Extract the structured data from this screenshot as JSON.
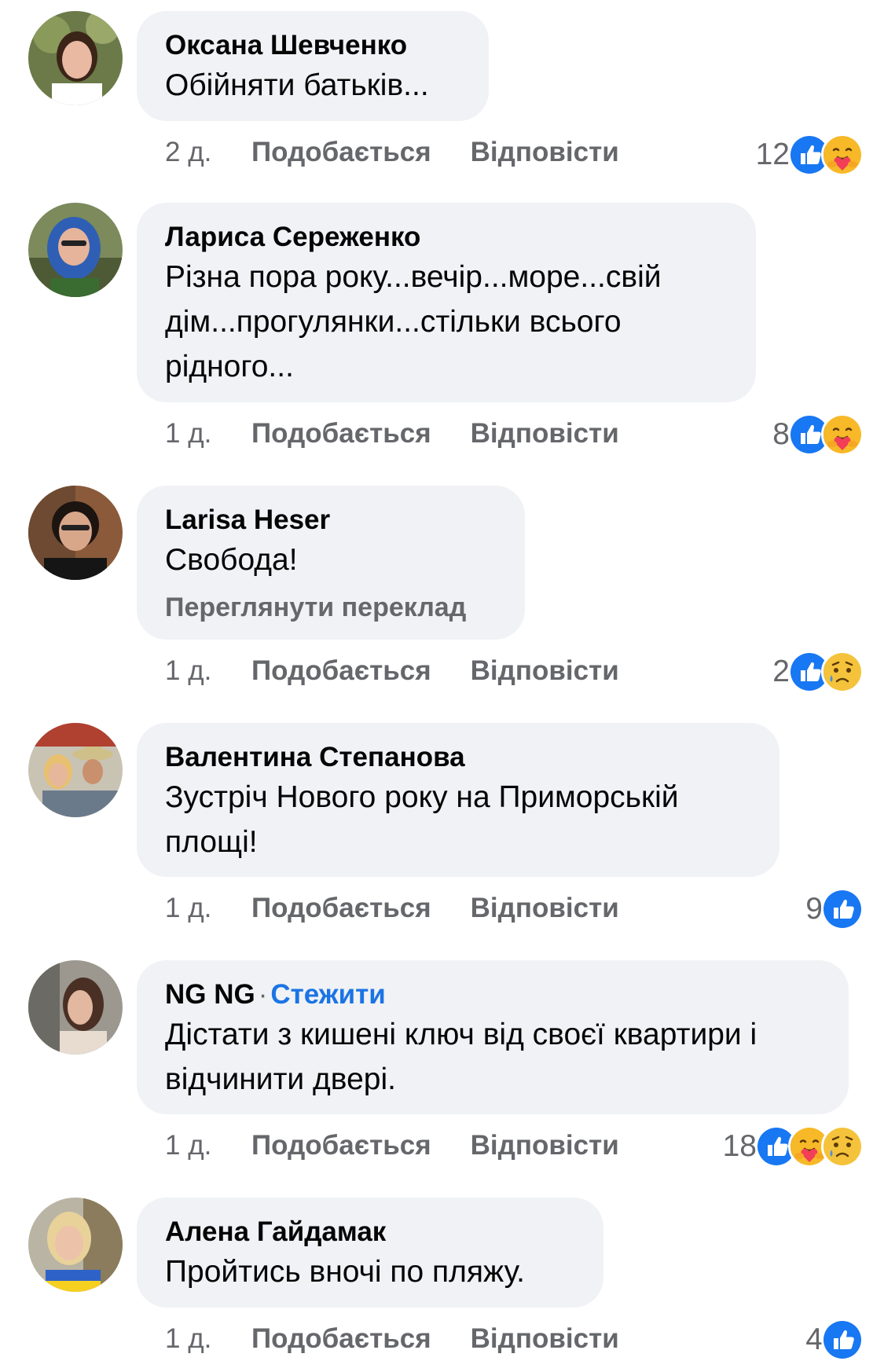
{
  "colors": {
    "bubble_bg": "#f0f2f5",
    "meta_text": "#65676b",
    "follow_link": "#1b74e4",
    "like_blue": "#1877f2",
    "care_yellow": "#f7b928",
    "sad_yellow": "#f5c33b"
  },
  "comments": [
    {
      "author": "Оксана Шевченко",
      "text": "Обійняти батьків...",
      "time": "2 д.",
      "like_label": "Подобається",
      "reply_label": "Відповісти",
      "reaction_count": "12",
      "reactions": [
        "like-icon",
        "care-icon"
      ]
    },
    {
      "author": "Лариса Сереженко",
      "text": "Різна пора року...вечір...море...свій дім...прогулянки...стільки всього рідного...",
      "time": "1 д.",
      "like_label": "Подобається",
      "reply_label": "Відповісти",
      "reaction_count": "8",
      "reactions": [
        "like-icon",
        "care-icon"
      ]
    },
    {
      "author": "Larisa Heser",
      "text": "Свобода!",
      "translate_label": "Переглянути переклад",
      "time": "1 д.",
      "like_label": "Подобається",
      "reply_label": "Відповісти",
      "reaction_count": "2",
      "reactions": [
        "like-icon",
        "sad-icon"
      ]
    },
    {
      "author": "Валентина Степанова",
      "text": "Зустріч Нового року на Приморській площі!",
      "time": "1 д.",
      "like_label": "Подобається",
      "reply_label": "Відповісти",
      "reaction_count": "9",
      "reactions": [
        "like-icon"
      ]
    },
    {
      "author": "NG NG",
      "separator": "·",
      "follow_label": "Стежити",
      "text": "Дістати з кишені ключ від своєї квартири і відчинити двері.",
      "time": "1 д.",
      "like_label": "Подобається",
      "reply_label": "Відповісти",
      "reaction_count": "18",
      "reactions": [
        "like-icon",
        "care-icon",
        "sad-icon"
      ]
    },
    {
      "author": "Алена Гайдамак",
      "text": "Пройтись вночі по пляжу.",
      "time": "1 д.",
      "like_label": "Подобається",
      "reply_label": "Відповісти",
      "reaction_count": "4",
      "reactions": [
        "like-icon"
      ]
    }
  ]
}
